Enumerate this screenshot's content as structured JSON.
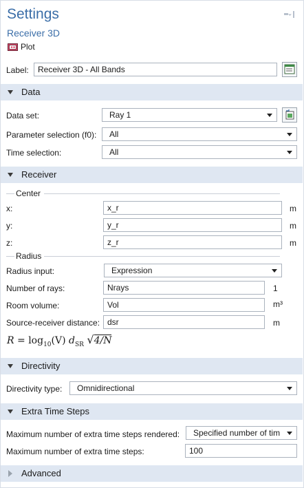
{
  "header": {
    "title": "Settings",
    "subtitle": "Receiver 3D",
    "plot_label": "Plot"
  },
  "label_row": {
    "label": "Label:",
    "value": "Receiver 3D - All Bands"
  },
  "data_section": {
    "title": "Data",
    "dataset_label": "Data set:",
    "dataset_value": "Ray 1",
    "param_label": "Parameter selection (f0):",
    "param_value": "All",
    "time_label": "Time selection:",
    "time_value": "All"
  },
  "receiver_section": {
    "title": "Receiver",
    "center_group": "Center",
    "x_label": "x:",
    "x_value": "x_r",
    "x_unit": "m",
    "y_label": "y:",
    "y_value": "y_r",
    "y_unit": "m",
    "z_label": "z:",
    "z_value": "z_r",
    "z_unit": "m",
    "radius_group": "Radius",
    "radius_input_label": "Radius input:",
    "radius_input_value": "Expression",
    "rays_label": "Number of rays:",
    "rays_value": "Nrays",
    "rays_unit": "1",
    "volume_label": "Room volume:",
    "volume_value": "Vol",
    "volume_unit": "m³",
    "dsr_label": "Source-receiver distance:",
    "dsr_value": "dsr",
    "dsr_unit": "m",
    "formula": {
      "lhs": "R",
      "eq": "=",
      "fn": "log",
      "fn_sub": "10",
      "arg": "(V)",
      "d": "d",
      "d_sub": "SR",
      "radicand": "4/N"
    }
  },
  "directivity_section": {
    "title": "Directivity",
    "type_label": "Directivity type:",
    "type_value": "Omnidirectional"
  },
  "extra_time_section": {
    "title": "Extra Time Steps",
    "rendered_label": "Maximum number of extra time steps rendered:",
    "rendered_value": "Specified number of tim",
    "max_label": "Maximum number of extra time steps:",
    "max_value": "100"
  },
  "advanced_section": {
    "title": "Advanced"
  },
  "colors": {
    "title": "#3b6ea8",
    "section_bg": "#dfe7f2"
  },
  "icons": {
    "pin": "pin-icon",
    "plot": "plot-icon",
    "label_edit": "label-edit-icon",
    "dataset_goto": "goto-dataset-icon"
  }
}
